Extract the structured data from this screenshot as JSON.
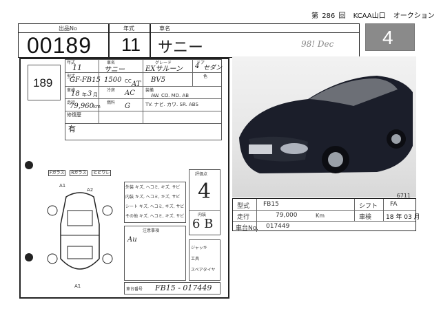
{
  "header": {
    "prefix": "第",
    "session": "286",
    "session_unit": "回",
    "venue": "KCAA山口",
    "event": "オークション"
  },
  "top_labels": {
    "lot_label": "出品No",
    "year_label": "年式",
    "car_name_label": "車名"
  },
  "top_values": {
    "lot_number": "00189",
    "year": "11",
    "car_name": "サニー",
    "date_note": "98! Dec",
    "score": "4"
  },
  "sheet": {
    "lot_small": "189",
    "row1": {
      "year": "11",
      "name": "サニー",
      "grade": "EXサルーン",
      "doors": "4",
      "body": "セダン"
    },
    "row2": {
      "model_code": "GF-FB15",
      "cc": "1500",
      "cc_unit": "CC",
      "shift": "AT",
      "color_code": "BV5",
      "color_label": "色"
    },
    "row3": {
      "inspection_year": "18",
      "inspection_year_unit": "年",
      "inspection_month": "3",
      "inspection_month_unit": "月",
      "ac": "AC",
      "gas": "G"
    },
    "row4": {
      "mileage": "79,960",
      "mileage_unit": "km"
    },
    "equipment": "AW. CO. MD. AB",
    "equipment2": "TV. ナビ. カワ. SR. ABS",
    "equipment_label": "装備",
    "repair_label": "修復歴",
    "repair_value": "有",
    "labels": {
      "year": "年式",
      "name": "車名",
      "grade": "グレード",
      "doors": "ドア",
      "body": "形状",
      "model": "型式",
      "cc": "排気量",
      "shift": "シフト",
      "inspection": "車検",
      "ac": "冷房",
      "fuel": "燃料",
      "mileage": "走行"
    },
    "score_hand": "4",
    "interior_hand": "6 B",
    "notes_hand": "Au",
    "chassis_hand": "FB15 - 017449",
    "chassis_label": "車台番号",
    "mini_labels": [
      "Fガラス",
      "Rガラス",
      "ヒビワレ"
    ],
    "check_labels": [
      "ジャッキ",
      "工具",
      "スペアタイヤ"
    ],
    "opt_rows": [
      "キズ, ヘコミ, キズ, サビ",
      "キズ, ヘコミ, キズ, サビ",
      "キズ, ヘコミ, キズ, サビ",
      "キズ, ヘコミ, キズ, サビ"
    ],
    "opt_labels": [
      "外装",
      "内装",
      "シート",
      "その他"
    ],
    "score_label": "評価点",
    "interior_label": "内装",
    "notes_label": "注意事項",
    "mark_a1": "A1",
    "mark_a2": "A2"
  },
  "photo": {
    "plate_note": "6711"
  },
  "info_table": {
    "model_label": "型式",
    "model_value": "FB15",
    "shift_label": "シフト",
    "shift_value": "FA",
    "mileage_label": "走行",
    "mileage_value": "79,000",
    "mileage_unit": "Km",
    "inspection_label": "車検",
    "inspection_year": "18",
    "inspection_year_unit": "年",
    "inspection_month": "03",
    "inspection_month_unit": "月",
    "chassis_label": "車台No.",
    "chassis_value": "017449"
  }
}
